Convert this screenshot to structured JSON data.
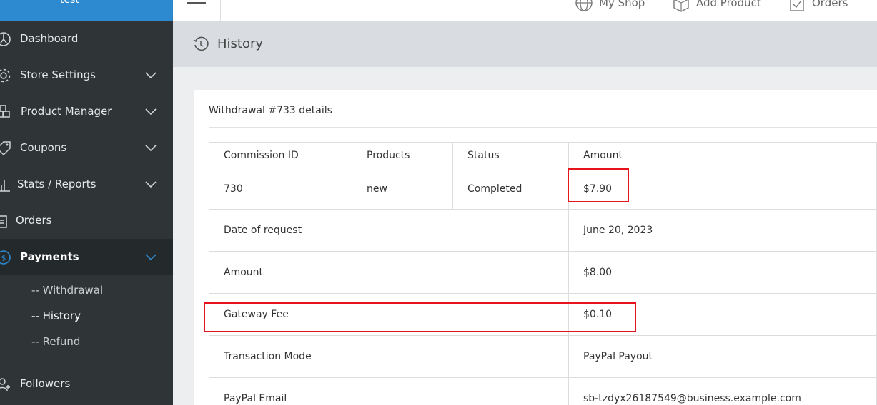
{
  "sidebar": {
    "store_name": "test",
    "items": [
      {
        "label": "Dashboard",
        "icon": "dashboard-icon"
      },
      {
        "label": "Store Settings",
        "icon": "gear-icon"
      },
      {
        "label": "Product Manager",
        "icon": "boxes-icon"
      },
      {
        "label": "Coupons",
        "icon": "tag-icon"
      },
      {
        "label": "Stats / Reports",
        "icon": "bar-chart-icon"
      },
      {
        "label": "Orders",
        "icon": "clipboard-icon"
      },
      {
        "label": "Payments",
        "icon": "dollar-icon"
      },
      {
        "label": "Followers",
        "icon": "user-plus-icon"
      }
    ],
    "payments_sub": [
      "-- Withdrawal",
      "-- History",
      "-- Refund"
    ]
  },
  "topbar": {
    "links": [
      "My Shop",
      "Add Product",
      "Orders"
    ]
  },
  "header": {
    "title": "History"
  },
  "card": {
    "title": "Withdrawal #733 details",
    "columns": [
      "Commission ID",
      "Products",
      "Status",
      "Amount"
    ],
    "row": {
      "commission_id": "730",
      "products": "new",
      "status": "Completed",
      "amount": "$7.90"
    },
    "details": [
      {
        "label": "Date of request",
        "value": "June 20, 2023"
      },
      {
        "label": "Amount",
        "value": "$8.00"
      },
      {
        "label": "Gateway Fee",
        "value": "$0.10"
      },
      {
        "label": "Transaction Mode",
        "value": "PayPal Payout"
      },
      {
        "label": "PayPal Email",
        "value": "sb-tzdyx26187549@business.example.com"
      }
    ]
  },
  "colors": {
    "sidebar_bg": "#2f3437",
    "accent": "#2d8ad0",
    "highlight": "#e8141b"
  }
}
